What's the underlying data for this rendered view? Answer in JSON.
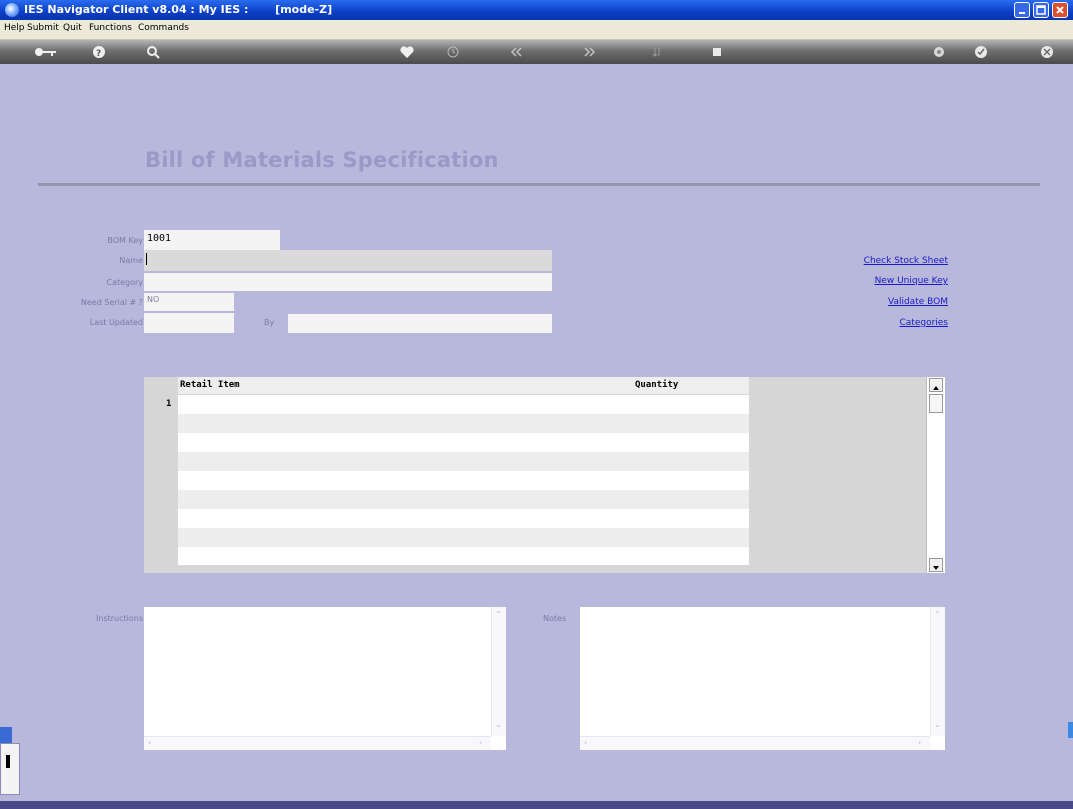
{
  "window": {
    "title": "IES Navigator Client v8.04 : My IES :       [mode-Z]",
    "minimize_icon": "minimize-icon",
    "maximize_icon": "maximize-icon",
    "close_icon": "close-icon"
  },
  "menu": {
    "items": [
      "Help",
      "Submit",
      "Quit",
      "Functions",
      "Commands"
    ]
  },
  "toolbar": {
    "icons": [
      "key-icon",
      "help-icon",
      "search-icon",
      "heart-icon",
      "clock-icon",
      "first-icon",
      "last-icon",
      "sort-icon",
      "stop-icon",
      "record-icon",
      "ok-icon",
      "exit-icon"
    ]
  },
  "page": {
    "title": "Bill of Materials Specification"
  },
  "form": {
    "bom_key_label": "BOM Key",
    "bom_key_value": "1001",
    "name_label": "Name",
    "name_value": "",
    "category_label": "Category",
    "category_value": "",
    "need_serial_label": "Need Serial # ?",
    "need_serial_value": "NO",
    "last_updated_label": "Last Updated",
    "last_updated_value": "",
    "by_label": "By",
    "by_value": ""
  },
  "links": {
    "check_stock_sheet": "Check Stock Sheet",
    "new_unique_key": "New Unique Key",
    "validate_bom": "Validate BOM",
    "categories": "Categories"
  },
  "grid": {
    "columns": [
      "Retail Item",
      "Quantity"
    ],
    "rows": [
      {
        "num": "1",
        "item": "",
        "quantity": ""
      }
    ]
  },
  "memo": {
    "instructions_label": "Instructions",
    "notes_label": "Notes"
  },
  "colors": {
    "background": "#b8b8dc",
    "title_blue": "#0a3fc4",
    "heading": "#9a9ac8",
    "link": "#1a1ac8"
  }
}
